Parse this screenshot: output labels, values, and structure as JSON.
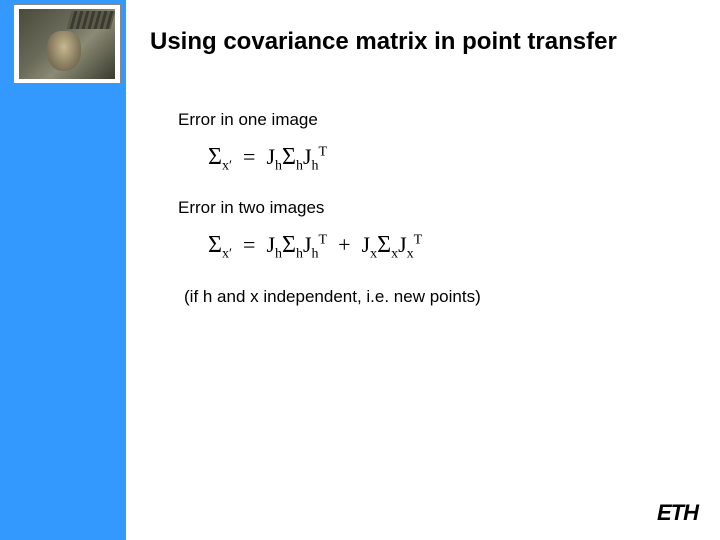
{
  "title": "Using covariance matrix in point transfer",
  "labels": {
    "one_image": "Error in one image",
    "two_images": "Error in two images",
    "note": "(if h and x independent, i.e. new points)"
  },
  "equations": {
    "eq1": {
      "lhs_base": "Σ",
      "lhs_sub": "x′",
      "terms": [
        {
          "J": "J",
          "Jsub": "h",
          "S": "Σ",
          "Ssub": "h",
          "Jt": "J",
          "Jtsub": "h",
          "Jtsup": "T"
        }
      ]
    },
    "eq2": {
      "lhs_base": "Σ",
      "lhs_sub": "x′",
      "terms": [
        {
          "J": "J",
          "Jsub": "h",
          "S": "Σ",
          "Ssub": "h",
          "Jt": "J",
          "Jtsub": "h",
          "Jtsup": "T"
        },
        {
          "J": "J",
          "Jsub": "x",
          "S": "Σ",
          "Ssub": "x",
          "Jt": "J",
          "Jtsub": "x",
          "Jtsup": "T"
        }
      ]
    }
  },
  "footer": {
    "org": "ETH"
  },
  "icons": {
    "corner": "medusa-relief"
  }
}
